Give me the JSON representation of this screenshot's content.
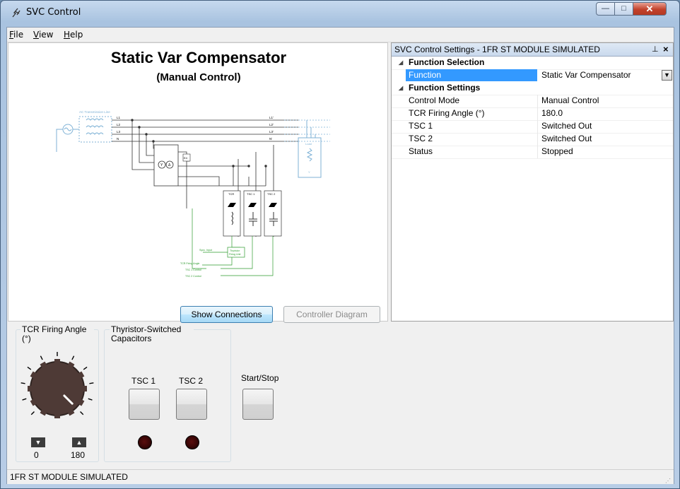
{
  "window": {
    "title": "SVC Control",
    "minimize": "—",
    "maximize": "□",
    "close": "✕"
  },
  "menu": [
    {
      "label": "File",
      "key": "F",
      "rest": "ile"
    },
    {
      "label": "View",
      "key": "V",
      "rest": "iew"
    },
    {
      "label": "Help",
      "key": "H",
      "rest": "elp"
    }
  ],
  "diagram": {
    "title": "Static Var Compensator",
    "subtitle": "(Manual Control)",
    "labels": {
      "ac_line": "AC Transmission Line",
      "l1": "L1",
      "l2": "L2",
      "l3": "L3",
      "n": "N",
      "l1p": "L1'",
      "l2p": "L2'",
      "l3p": "L3'",
      "np": "N'",
      "load": "Load",
      "e4": "E4",
      "y": "Y",
      "tcr": "TCR",
      "tsc1": "TSC 1",
      "tsc2": "TSC 2",
      "sync": "Sync. Input",
      "thyristor": "Thyristor",
      "firing": "Firing Unit",
      "tcr_firing": "TCR Firing Angle",
      "tsc1_ctrl": "TSC 1 Control",
      "tsc2_ctrl": "TSC 2 Control",
      "yd": "Y",
      "delta": "Δ"
    },
    "show_connections": "Show Connections",
    "controller_diagram": "Controller Diagram"
  },
  "settings": {
    "header": "SVC Control Settings - 1FR ST MODULE SIMULATED",
    "pin": "ᵃ",
    "categories": {
      "function_selection": "Function Selection",
      "function_settings": "Function Settings"
    },
    "function": {
      "name": "Function",
      "value": "Static Var Compensator"
    },
    "rows": [
      {
        "name": "Control Mode",
        "value": "Manual Control"
      },
      {
        "name": "TCR Firing Angle (°)",
        "value": "180.0"
      },
      {
        "name": "TSC 1",
        "value": "Switched Out"
      },
      {
        "name": "TSC 2",
        "value": "Switched Out"
      },
      {
        "name": "Status",
        "value": "Stopped"
      }
    ]
  },
  "controls": {
    "tcr_group_label": "TCR Firing Angle (°)",
    "knob_min": "0",
    "knob_max": "180",
    "knob_value_fraction": 1.0,
    "tsc_group_label": "Thyristor-Switched Capacitors",
    "tsc1": "TSC 1",
    "tsc2": "TSC 2",
    "start_stop": "Start/Stop",
    "led_color": "#3b0606"
  },
  "status": {
    "text": "1FR ST MODULE SIMULATED"
  },
  "colors": {
    "accent_select": "#3399ff",
    "schematic_blue": "#7fb2d6",
    "schematic_green": "#2e9b2e",
    "knob": "#4e3a36"
  }
}
